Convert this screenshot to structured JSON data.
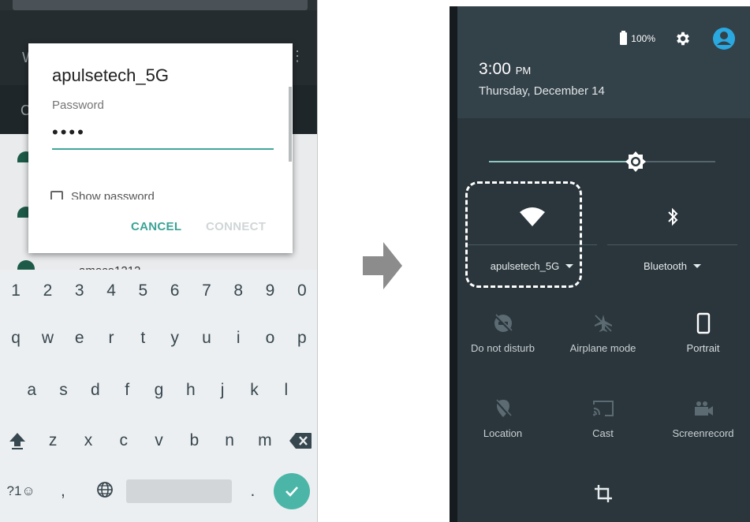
{
  "left_screen": {
    "dialog": {
      "title": "apulsetech_5G",
      "password_label": "Password",
      "password_value": "••••",
      "show_password_label": "Show password",
      "cancel_label": "CANCEL",
      "connect_label": "CONNECT"
    },
    "background_list": {
      "partial_network_name": "amoco1212"
    },
    "keyboard": {
      "number_row": [
        "1",
        "2",
        "3",
        "4",
        "5",
        "6",
        "7",
        "8",
        "9",
        "0"
      ],
      "row1": [
        "q",
        "w",
        "e",
        "r",
        "t",
        "y",
        "u",
        "i",
        "o",
        "p"
      ],
      "row2": [
        "a",
        "s",
        "d",
        "f",
        "g",
        "h",
        "j",
        "k",
        "l"
      ],
      "row3": [
        "z",
        "x",
        "c",
        "v",
        "b",
        "n",
        "m"
      ],
      "symbols_key": "?1☺",
      "comma_key": ",",
      "period_key": "."
    }
  },
  "right_screen": {
    "status": {
      "battery_percent": "100%"
    },
    "time": "3:00",
    "time_suffix": "PM",
    "date": "Thursday, December 14",
    "brightness_level": 0.6,
    "large_tiles": {
      "wifi_label": "apulsetech_5G",
      "bluetooth_label": "Bluetooth"
    },
    "small_tiles": [
      {
        "label": "Do not disturb",
        "icon": "do-not-disturb-icon"
      },
      {
        "label": "Airplane mode",
        "icon": "airplane-icon"
      },
      {
        "label": "Portrait",
        "icon": "portrait-icon"
      },
      {
        "label": "Location",
        "icon": "location-icon"
      },
      {
        "label": "Cast",
        "icon": "cast-icon"
      },
      {
        "label": "Screenrecord",
        "icon": "screenrecord-icon"
      }
    ]
  },
  "colors": {
    "accent": "#3aa395",
    "qs_background": "#2a363c",
    "qs_header": "#334149",
    "keyboard_bg": "#eceff1"
  }
}
